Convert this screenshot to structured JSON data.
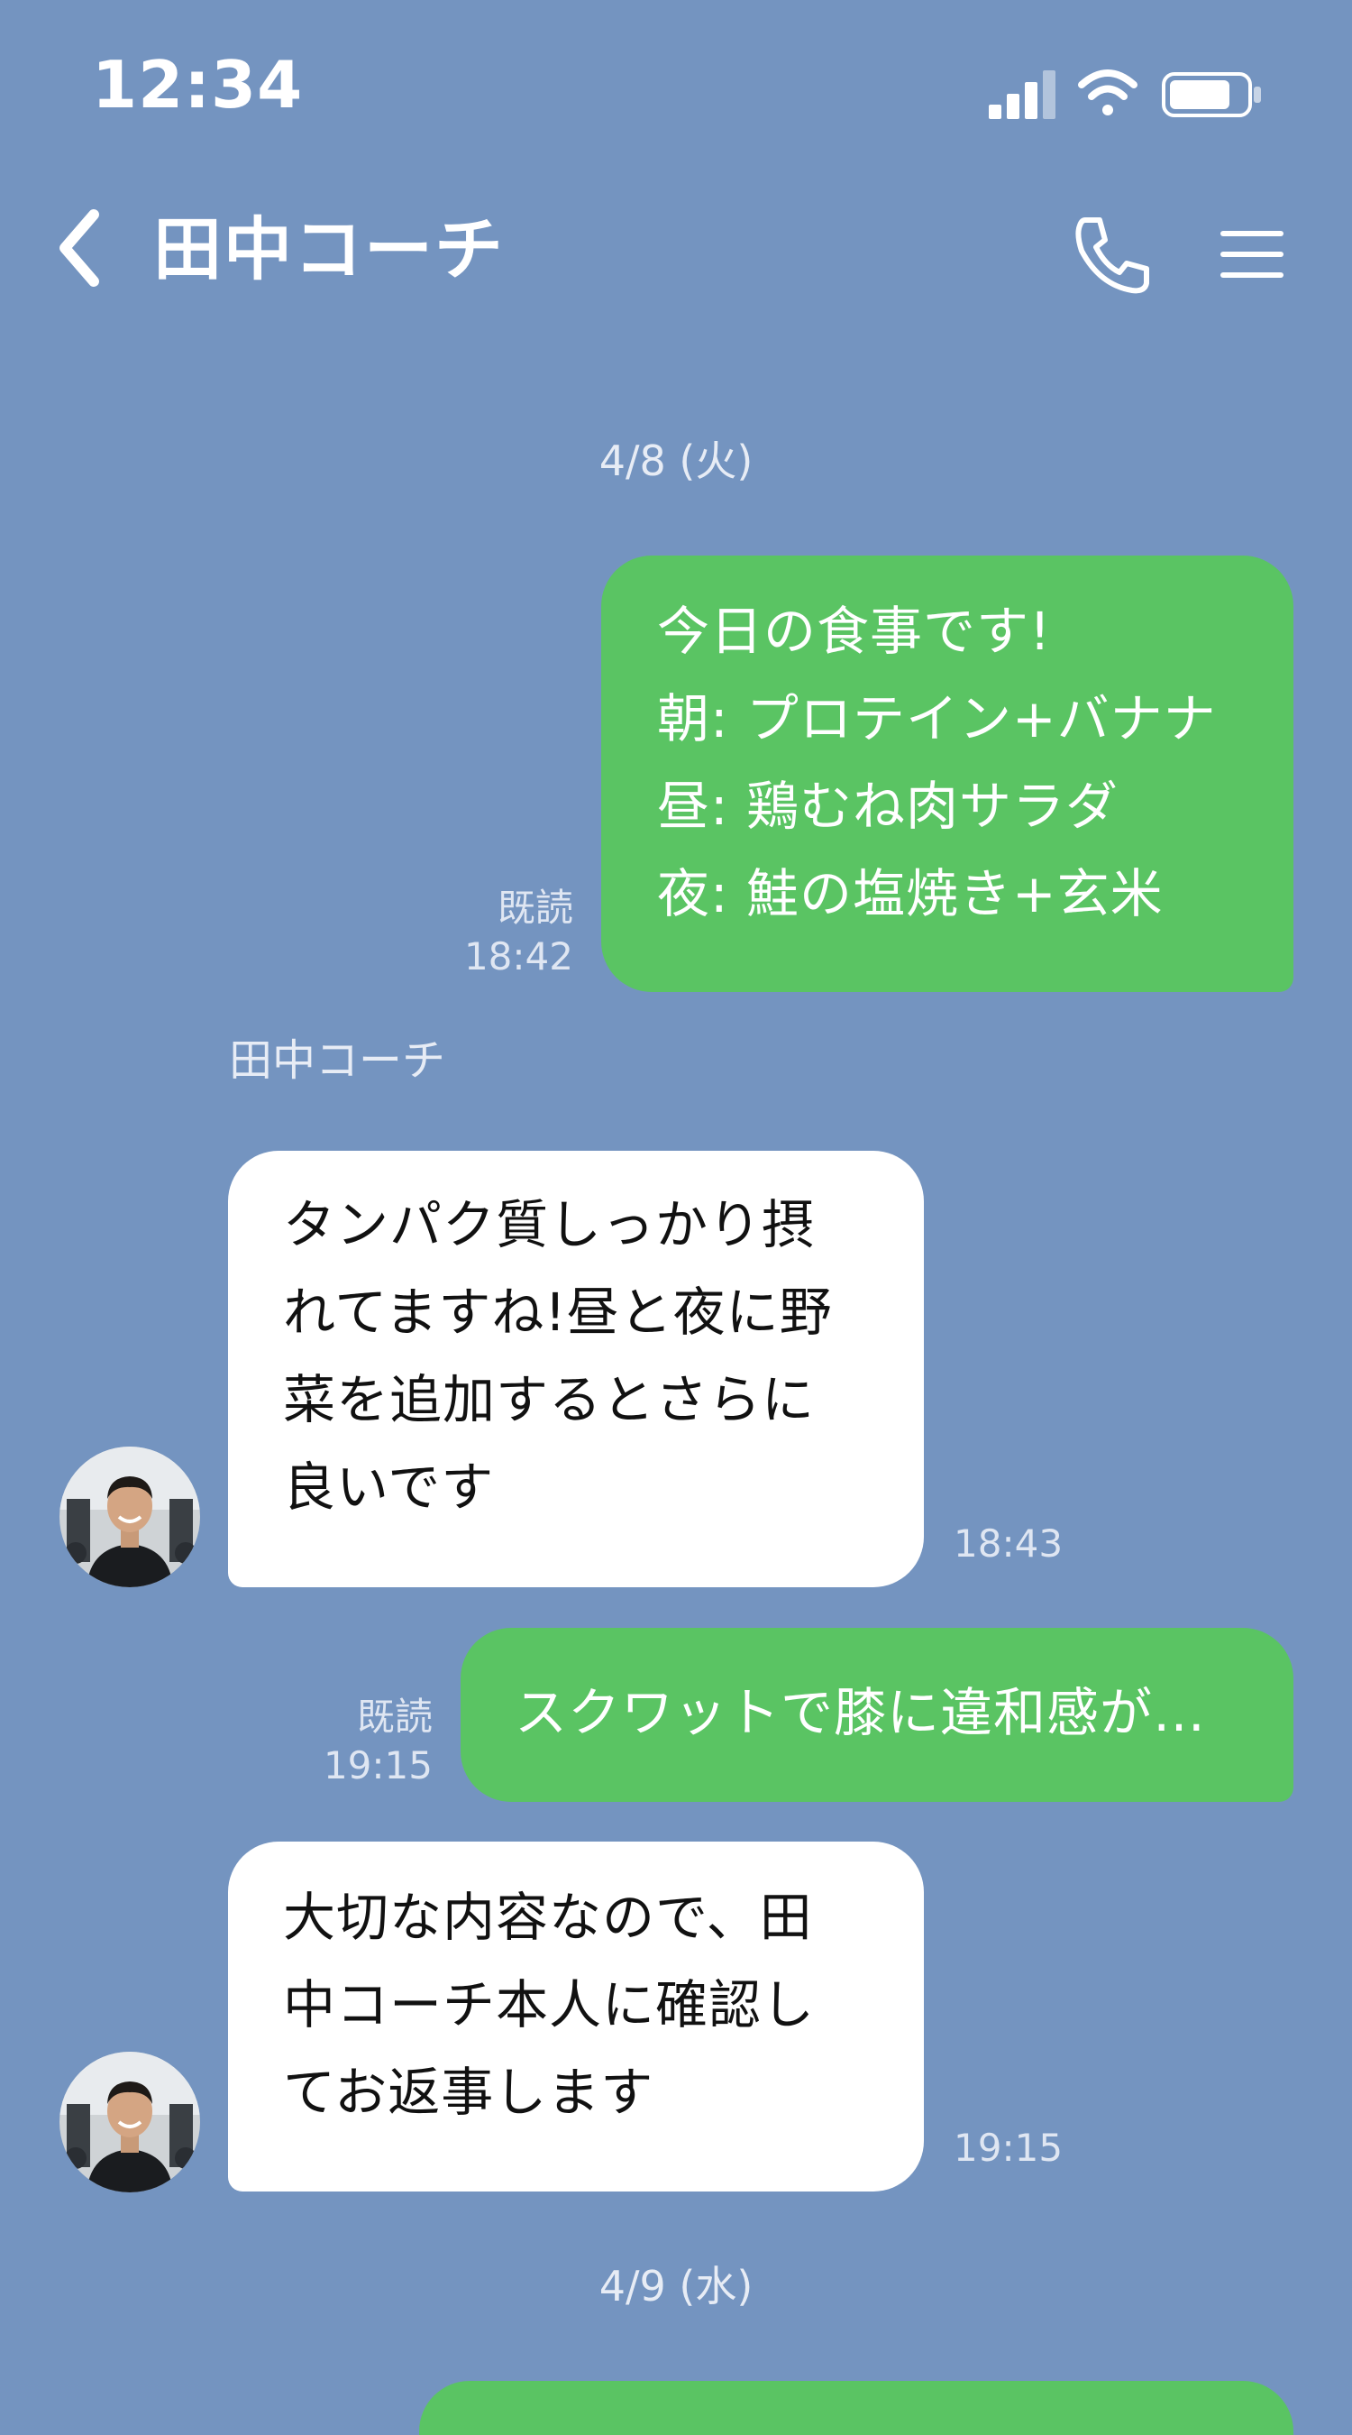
{
  "status_bar": {
    "time": "12:34"
  },
  "header": {
    "title": "田中コーチ"
  },
  "messages": {
    "date_1": "4/8 (火)",
    "msg1": {
      "text": "今日の食事です!\n朝: プロテイン+バナナ\n昼: 鶏むね肉サラダ\n夜: 鮭の塩焼き+玄米",
      "read": "既読",
      "time": "18:42"
    },
    "sender_name": "田中コーチ",
    "msg2": {
      "text": "タンパク質しっかり摂\nれてますね!昼と夜に野\n菜を追加するとさらに\n良いです",
      "time": "18:43"
    },
    "msg3": {
      "text": "スクワットで膝に違和感が…",
      "read": "既読",
      "time": "19:15"
    },
    "msg4": {
      "text": "大切な内容なので、田\n中コーチ本人に確認し\nてお返事します",
      "time": "19:15"
    },
    "date_2": "4/9 (水)"
  },
  "colors": {
    "background": "#7494c0",
    "my_bubble": "#5ac463",
    "their_bubble": "#ffffff"
  },
  "icons": [
    "signal-icon",
    "wifi-icon",
    "battery-icon",
    "back-icon",
    "phone-icon",
    "menu-icon"
  ]
}
